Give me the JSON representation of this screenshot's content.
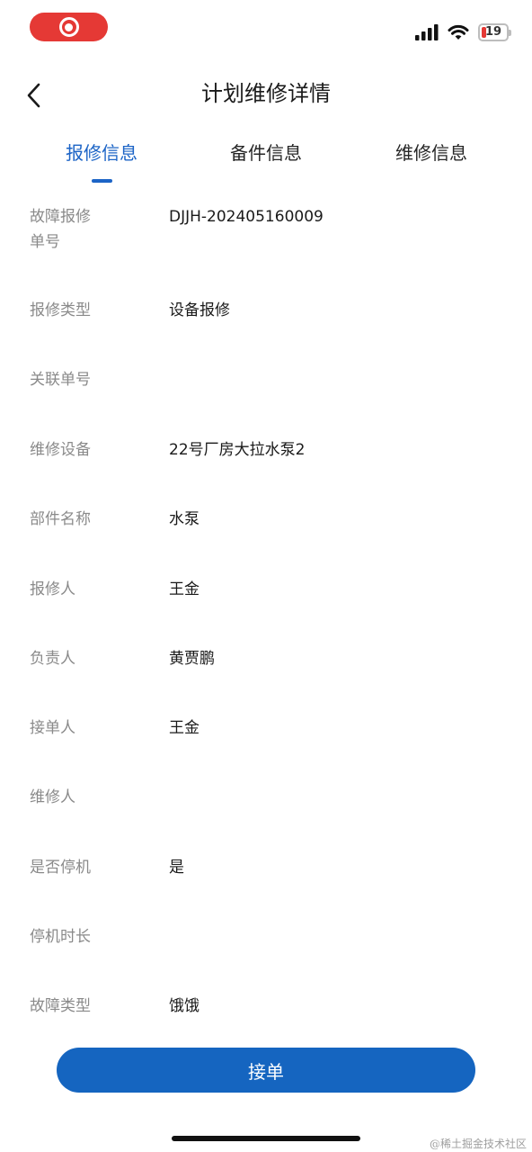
{
  "status_bar": {
    "battery_level": "19",
    "battery_color": "#e53935"
  },
  "header": {
    "title": "计划维修详情",
    "back_icon": "chevron-left-icon"
  },
  "tabs": [
    {
      "label": "报修信息",
      "active": true
    },
    {
      "label": "备件信息",
      "active": false
    },
    {
      "label": "维修信息",
      "active": false
    }
  ],
  "details": [
    {
      "label": "故障报修单号",
      "value": "DJJH-202405160009"
    },
    {
      "label": "报修类型",
      "value": "设备报修"
    },
    {
      "label": "关联单号",
      "value": ""
    },
    {
      "label": "维修设备",
      "value": "22号厂房大拉水泵2"
    },
    {
      "label": "部件名称",
      "value": "水泵"
    },
    {
      "label": "报修人",
      "value": "王金"
    },
    {
      "label": "负责人",
      "value": "黄贾鹏"
    },
    {
      "label": "接单人",
      "value": "王金"
    },
    {
      "label": "维修人",
      "value": ""
    },
    {
      "label": "是否停机",
      "value": "是"
    },
    {
      "label": "停机时长",
      "value": ""
    },
    {
      "label": "故障类型",
      "value": "饿饿"
    }
  ],
  "footer": {
    "accept_label": "接单",
    "watermark": "@稀土掘金技术社区"
  },
  "colors": {
    "accent": "#1c64c6",
    "button": "#1565c0",
    "label": "#8a8a8a",
    "value": "#1a1a1a"
  }
}
